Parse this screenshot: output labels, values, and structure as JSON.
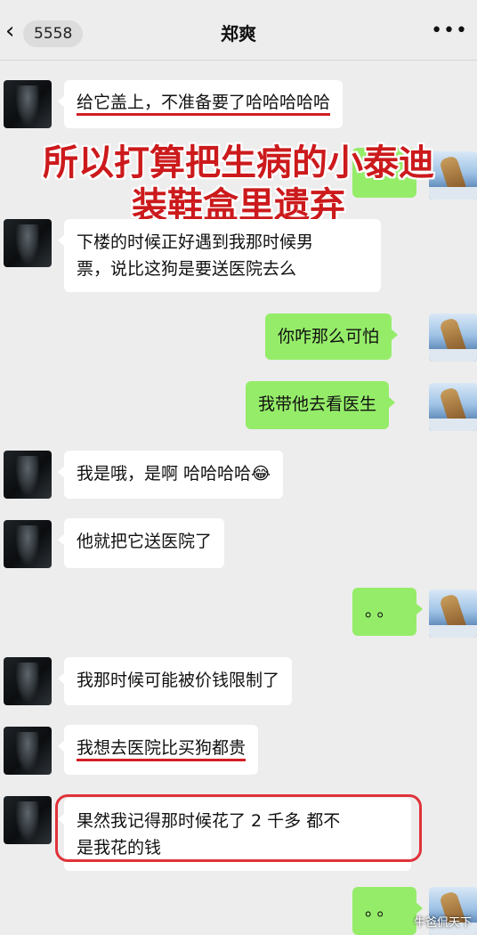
{
  "header": {
    "back_icon": "chevron-left-icon",
    "unread_count": "5558",
    "title": "郑爽",
    "more_icon": "more-dots-icon"
  },
  "overlay_caption": {
    "line1": "所以打算把生病的小泰迪",
    "line2": "装鞋盒里遗弃"
  },
  "messages": [
    {
      "side": "left",
      "text": "给它盖上，不准备要了哈哈哈哈哈",
      "highlight": "underline"
    },
    {
      "side": "right",
      "text": ""
    },
    {
      "side": "left",
      "text_lines": [
        "下楼的时候正好遇到我那时候男",
        "票，说比这狗是要送医院去么"
      ]
    },
    {
      "side": "right",
      "text": "你咋那么可怕"
    },
    {
      "side": "right",
      "text": "我带他去看医生"
    },
    {
      "side": "left",
      "text": "我是哦，是啊 哈哈哈哈😂"
    },
    {
      "side": "left",
      "text": "他就把它送医院了"
    },
    {
      "side": "right",
      "text": "。。"
    },
    {
      "side": "left",
      "text": "我那时候可能被价钱限制了"
    },
    {
      "side": "left",
      "text": "我想去医院比买狗都贵",
      "highlight": "underline"
    },
    {
      "side": "left",
      "text_lines": [
        "果然我记得那时候花了 2 千多 都不",
        "是我花的钱"
      ],
      "highlight": "box"
    },
    {
      "side": "right",
      "text": "。。"
    }
  ],
  "watermark": "牛爸侃天下",
  "colors": {
    "background": "#ededed",
    "incoming_bubble": "#ffffff",
    "outgoing_bubble": "#95ec69",
    "highlight_red": "#d11f24"
  }
}
